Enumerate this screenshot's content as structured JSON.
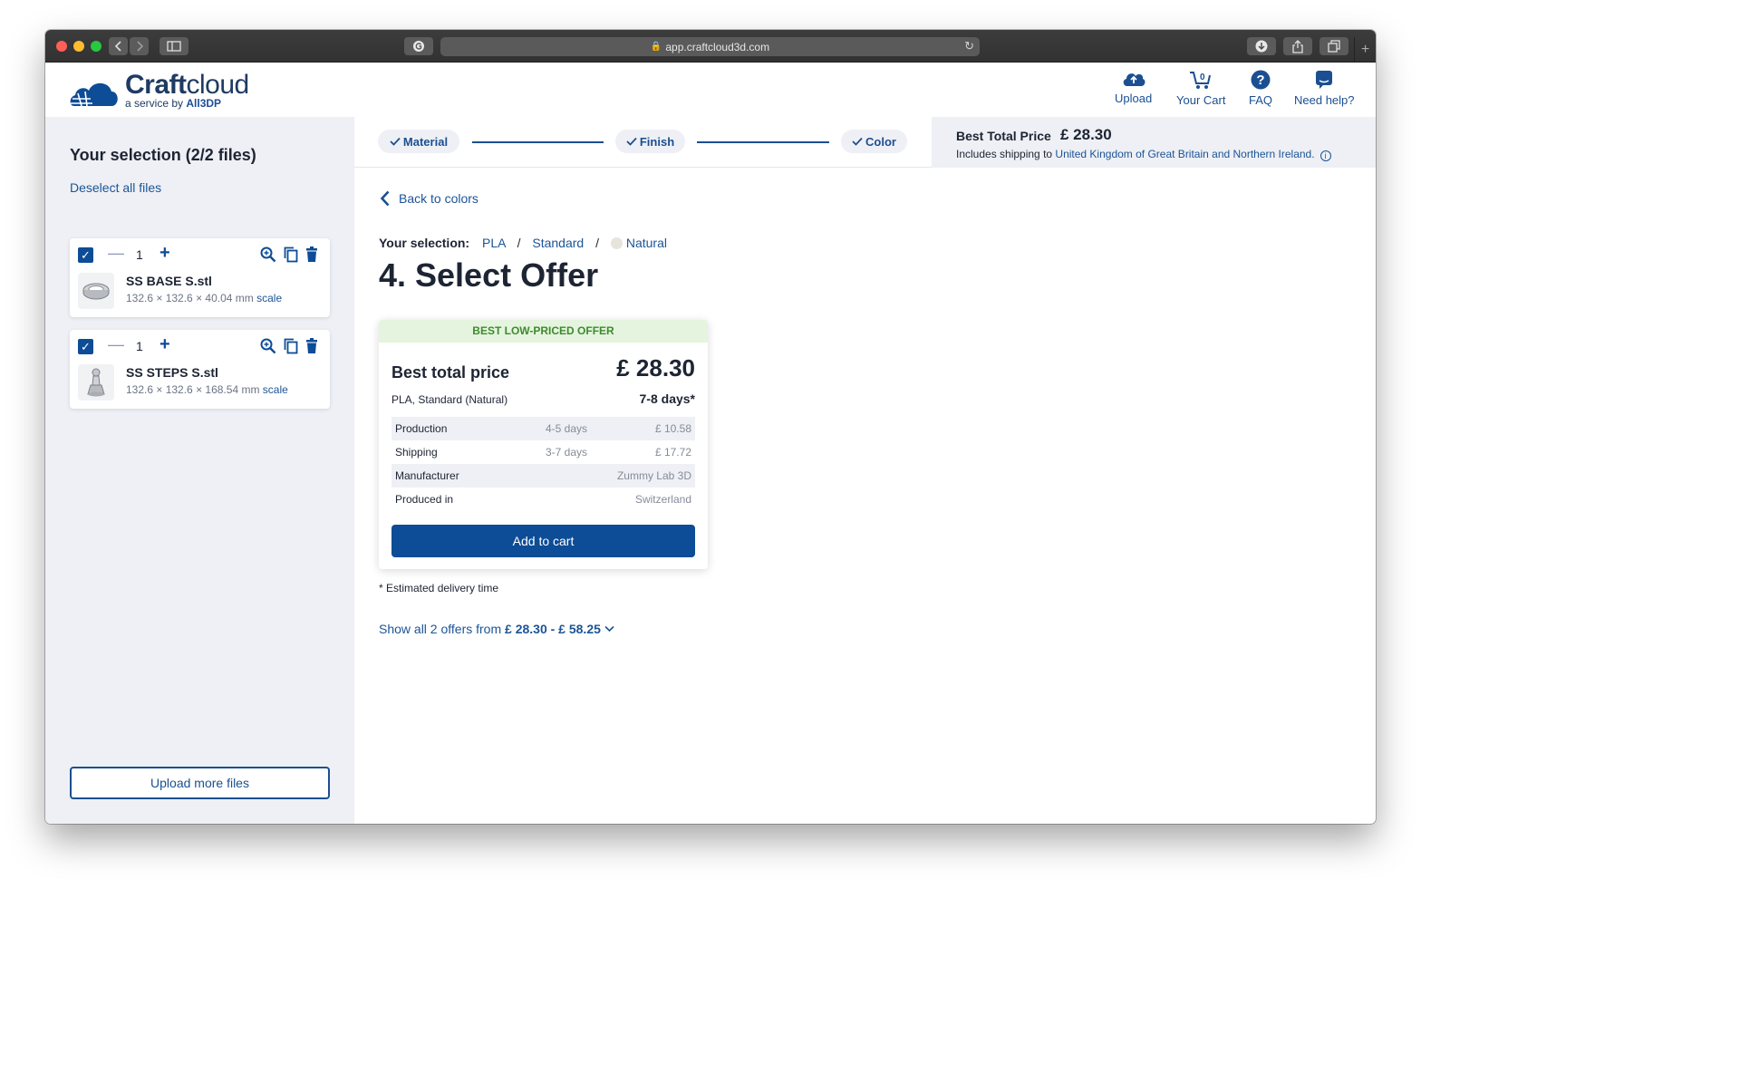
{
  "browser": {
    "url": "app.craftcloud3d.com"
  },
  "header": {
    "logo_main_bold": "Craft",
    "logo_main_rest": "cloud",
    "logo_sub_prefix": "a service by ",
    "logo_sub_brand": "All3DP",
    "nav": [
      {
        "label": "Upload",
        "icon": "cloud-upload-icon"
      },
      {
        "label": "Your Cart",
        "icon": "cart-icon",
        "count": "0"
      },
      {
        "label": "FAQ",
        "icon": "help-icon"
      },
      {
        "label": "Need help?",
        "icon": "chat-icon"
      }
    ]
  },
  "sidebar": {
    "title": "Your selection (2/2 files)",
    "deselect_label": "Deselect all files",
    "files": [
      {
        "name": "SS BASE S.stl",
        "quantity": "1",
        "dims": "132.6 × 132.6 × 40.04 mm",
        "scale_label": "scale",
        "checked": true
      },
      {
        "name": "SS STEPS S.stl",
        "quantity": "1",
        "dims": "132.6 × 132.6 × 168.54 mm",
        "scale_label": "scale",
        "checked": true
      }
    ],
    "upload_more_label": "Upload more files"
  },
  "steps": [
    {
      "label": "Material",
      "done": true
    },
    {
      "label": "Finish",
      "done": true
    },
    {
      "label": "Color",
      "done": true
    }
  ],
  "best_price": {
    "title": "Best Total Price",
    "price": "£ 28.30",
    "shipping_prefix": "Includes shipping to ",
    "country": "United Kingdom of Great Britain and Northern Ireland."
  },
  "main": {
    "back_label": "Back to colors",
    "selection_label": "Your selection:",
    "selection_material": "PLA",
    "selection_finish": "Standard",
    "selection_color": "Natural",
    "selection_color_hex": "#e7e4dc",
    "title": "4. Select Offer",
    "offer": {
      "badge": "BEST LOW-PRICED OFFER",
      "title": "Best total price",
      "price": "£ 28.30",
      "subtitle": "PLA, Standard (Natural)",
      "days": "7-8 days*",
      "rows": [
        {
          "label": "Production",
          "time": "4-5 days",
          "value": "£ 10.58"
        },
        {
          "label": "Shipping",
          "time": "3-7 days",
          "value": "£ 17.72"
        },
        {
          "label": "Manufacturer",
          "time": "",
          "value": "Zummy Lab 3D"
        },
        {
          "label": "Produced in",
          "time": "",
          "value": "Switzerland"
        }
      ],
      "cta": "Add to cart"
    },
    "estimate_note": "* Estimated delivery time",
    "show_all_prefix": "Show all 2 offers from ",
    "show_all_range": "£ 28.30 - £ 58.25"
  },
  "colors": {
    "brand_blue": "#0d4c96",
    "link_blue": "#1b5496",
    "sidebar_bg": "#eef0f5",
    "badge_green": "#3d8b2e",
    "badge_bg": "#e5f4df"
  }
}
